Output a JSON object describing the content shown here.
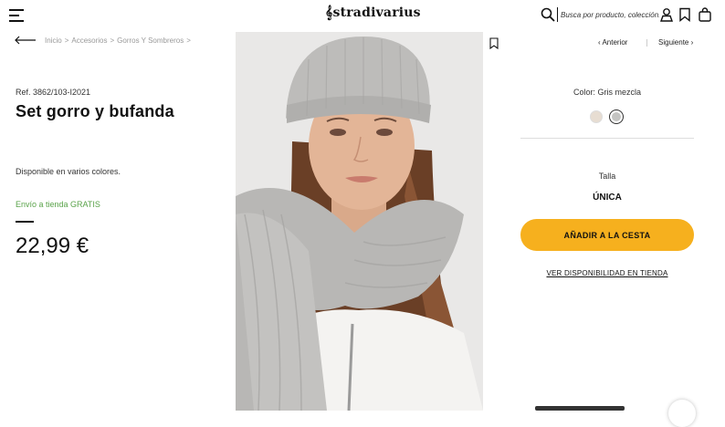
{
  "header": {
    "logo": "stradivarius",
    "search_placeholder": "Busca por producto, colección..."
  },
  "breadcrumb": {
    "items": [
      "Inicio",
      "Accesorios",
      "Gorros Y Sombreros"
    ],
    "separator": ">"
  },
  "product": {
    "ref": "Ref. 3862/103-I2021",
    "title": "Set gorro y bufanda",
    "availability": "Disponible en varios colores.",
    "shipping": "Envío a tienda GRATIS",
    "price": "22,99 €"
  },
  "nav": {
    "prev": "Anterior",
    "next": "Siguiente"
  },
  "options": {
    "color_label": "Color: Gris mezcla",
    "colors": [
      "#e7ddd2",
      "#c4c4c2"
    ],
    "size_label": "Talla",
    "size_value": "ÚNICA"
  },
  "actions": {
    "add_to_cart": "AÑADIR A LA CESTA",
    "store_availability": "VER DISPONIBILIDAD EN TIENDA"
  },
  "colors": {
    "accent": "#f6b01e",
    "shipping_green": "#5aa34a"
  }
}
